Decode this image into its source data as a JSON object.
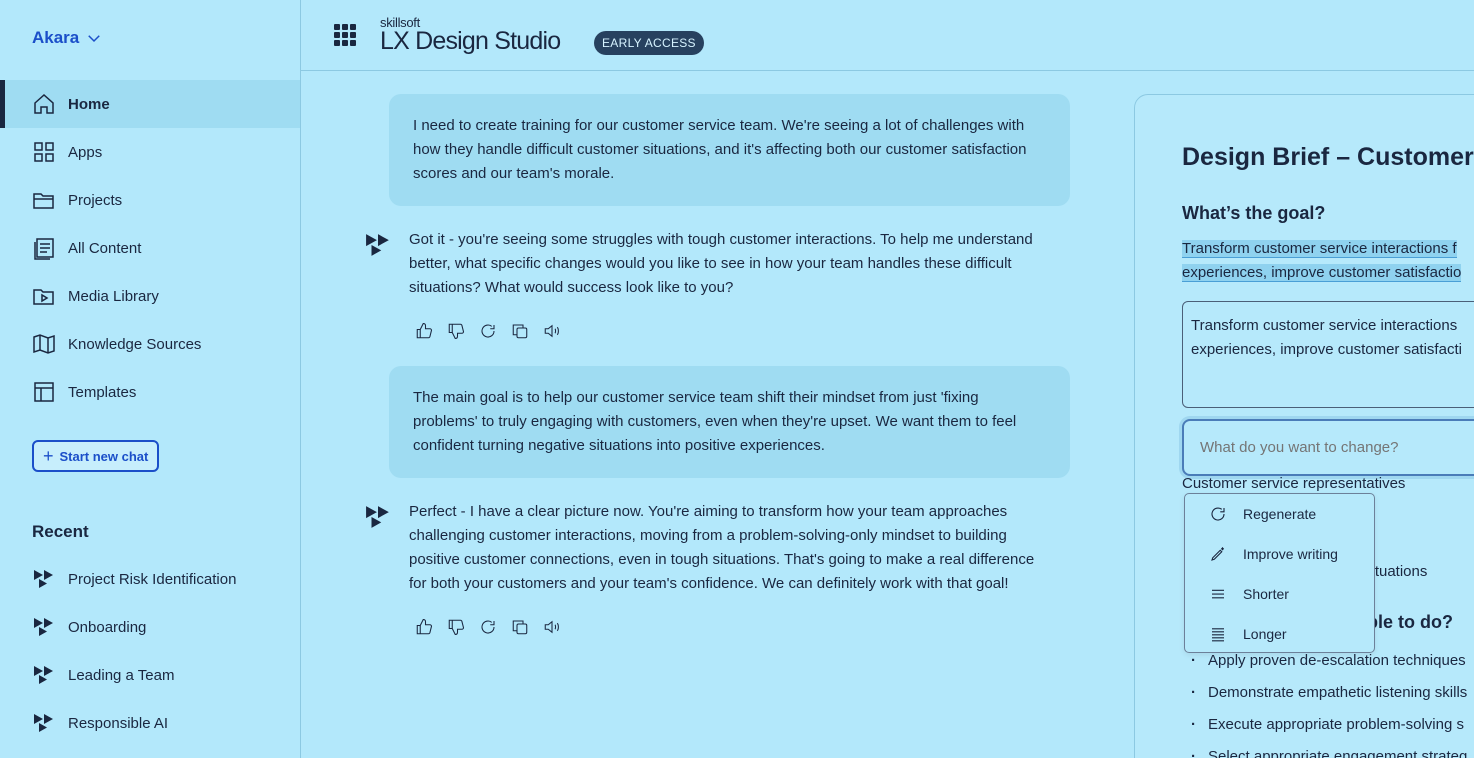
{
  "sidebar": {
    "org_name": "Akara",
    "nav": [
      {
        "label": "Home",
        "icon": "home-icon"
      },
      {
        "label": "Apps",
        "icon": "apps-grid-icon"
      },
      {
        "label": "Projects",
        "icon": "folder-icon"
      },
      {
        "label": "All Content",
        "icon": "document-list-icon"
      },
      {
        "label": "Media Library",
        "icon": "media-folder-icon"
      },
      {
        "label": "Knowledge Sources",
        "icon": "book-icon"
      },
      {
        "label": "Templates",
        "icon": "template-icon"
      }
    ],
    "new_chat_label": "Start new chat",
    "recent_title": "Recent",
    "recent": [
      {
        "label": "Project Risk Identification"
      },
      {
        "label": "Onboarding"
      },
      {
        "label": "Leading a Team"
      },
      {
        "label": "Responsible AI"
      }
    ]
  },
  "header": {
    "brand_small": "skillsoft",
    "brand_title": "LX Design Studio",
    "badge": "EARLY ACCESS"
  },
  "chat": {
    "messages": [
      {
        "role": "user",
        "text": "I need to create training for our customer service team. We're seeing a lot of challenges with how they handle difficult customer situations, and it's affecting both our customer satisfaction scores and our team's morale."
      },
      {
        "role": "assistant",
        "text": "Got it - you're seeing some struggles with tough customer interactions. To help me understand better, what specific changes would you like to see in how your team handles these difficult situations? What would success look like to you?"
      },
      {
        "role": "user",
        "text": "The main goal is to help our customer service team shift their mindset from just 'fixing problems' to truly engaging with customers, even when they're upset. We want them to feel confident turning negative situations into positive experiences."
      },
      {
        "role": "assistant",
        "text": "Perfect - I have a clear picture now. You're aiming to transform how your team approaches challenging customer interactions, moving from a problem-solving-only mindset to building positive customer connections, even in tough situations. That's going to make a real difference for both your customers and your team's confidence. We can definitely work with that goal!"
      }
    ]
  },
  "brief": {
    "title": "Design Brief – Customer",
    "goal_heading": "What’s the goal?",
    "goal_highlight_line1": "Transform customer service interactions f",
    "goal_highlight_line2": "experiences, improve customer satisfactio",
    "goal_edit_line1": "Transform customer service interactions",
    "goal_edit_line2": "experiences, improve customer satisfacti",
    "change_placeholder": "What do you want to change?",
    "audience": "Customer service representatives",
    "situations_fragment": "situations",
    "able_fragment": "able to do?",
    "bullets": [
      "Apply proven de-escalation techniques",
      "Demonstrate empathetic listening skills",
      "Execute appropriate problem-solving s",
      "Select appropriate engagement strateg"
    ]
  },
  "menu": {
    "items": [
      {
        "label": "Regenerate",
        "icon": "regenerate-icon"
      },
      {
        "label": "Improve writing",
        "icon": "pen-sparkle-icon"
      },
      {
        "label": "Shorter",
        "icon": "lines-short-icon"
      },
      {
        "label": "Longer",
        "icon": "lines-long-icon"
      }
    ]
  },
  "colors": {
    "background": "#b3e8fb",
    "accent": "#1b4fc9",
    "text": "#1a2740",
    "badge_bg": "#27415f"
  }
}
